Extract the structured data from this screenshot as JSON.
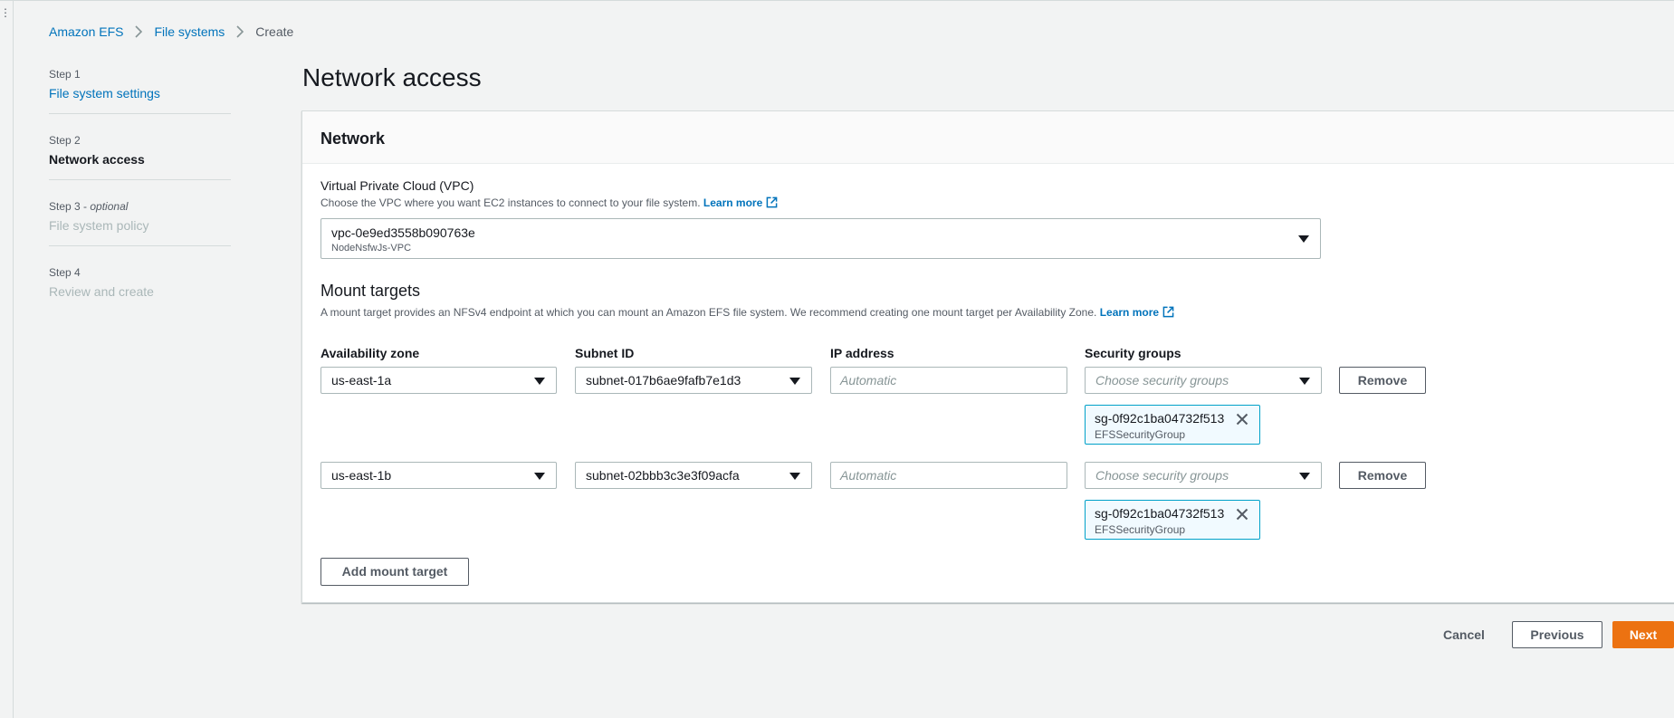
{
  "breadcrumbs": [
    "Amazon EFS",
    "File systems",
    "Create"
  ],
  "steps": [
    {
      "number": "Step 1",
      "optional": "",
      "label": "File system settings"
    },
    {
      "number": "Step 2",
      "optional": "",
      "label": "Network access"
    },
    {
      "number": "Step 3",
      "optional": "optional",
      "label": "File system policy"
    },
    {
      "number": "Step 4",
      "optional": "",
      "label": "Review and create"
    }
  ],
  "page_title": "Network access",
  "network": {
    "heading": "Network",
    "vpc_label": "Virtual Private Cloud (VPC)",
    "vpc_description": "Choose the VPC where you want EC2 instances to connect to your file system.",
    "learn_more": "Learn more",
    "vpc_value": "vpc-0e9ed3558b090763e",
    "vpc_name": "NodeNsfwJs-VPC"
  },
  "mount_targets": {
    "heading": "Mount targets",
    "description": "A mount target provides an NFSv4 endpoint at which you can mount an Amazon EFS file system. We recommend creating one mount target per Availability Zone.",
    "learn_more": "Learn more",
    "columns": [
      "Availability zone",
      "Subnet ID",
      "IP address",
      "Security groups"
    ],
    "ip_placeholder": "Automatic",
    "sg_placeholder": "Choose security groups",
    "remove_label": "Remove",
    "rows": [
      {
        "az": "us-east-1a",
        "subnet": "subnet-017b6ae9fafb7e1d3",
        "sg_id": "sg-0f92c1ba04732f513",
        "sg_name": "EFSSecurityGroup"
      },
      {
        "az": "us-east-1b",
        "subnet": "subnet-02bbb3c3e3f09acfa",
        "sg_id": "sg-0f92c1ba04732f513",
        "sg_name": "EFSSecurityGroup"
      }
    ],
    "add_label": "Add mount target"
  },
  "footer": {
    "cancel": "Cancel",
    "previous": "Previous",
    "next": "Next"
  },
  "colors": {
    "link": "#0073bb",
    "primary": "#ec7211",
    "token_border": "#00a1c9"
  },
  "icons": [
    "chevron-right-icon",
    "external-link-icon",
    "caret-down-icon",
    "close-icon"
  ]
}
